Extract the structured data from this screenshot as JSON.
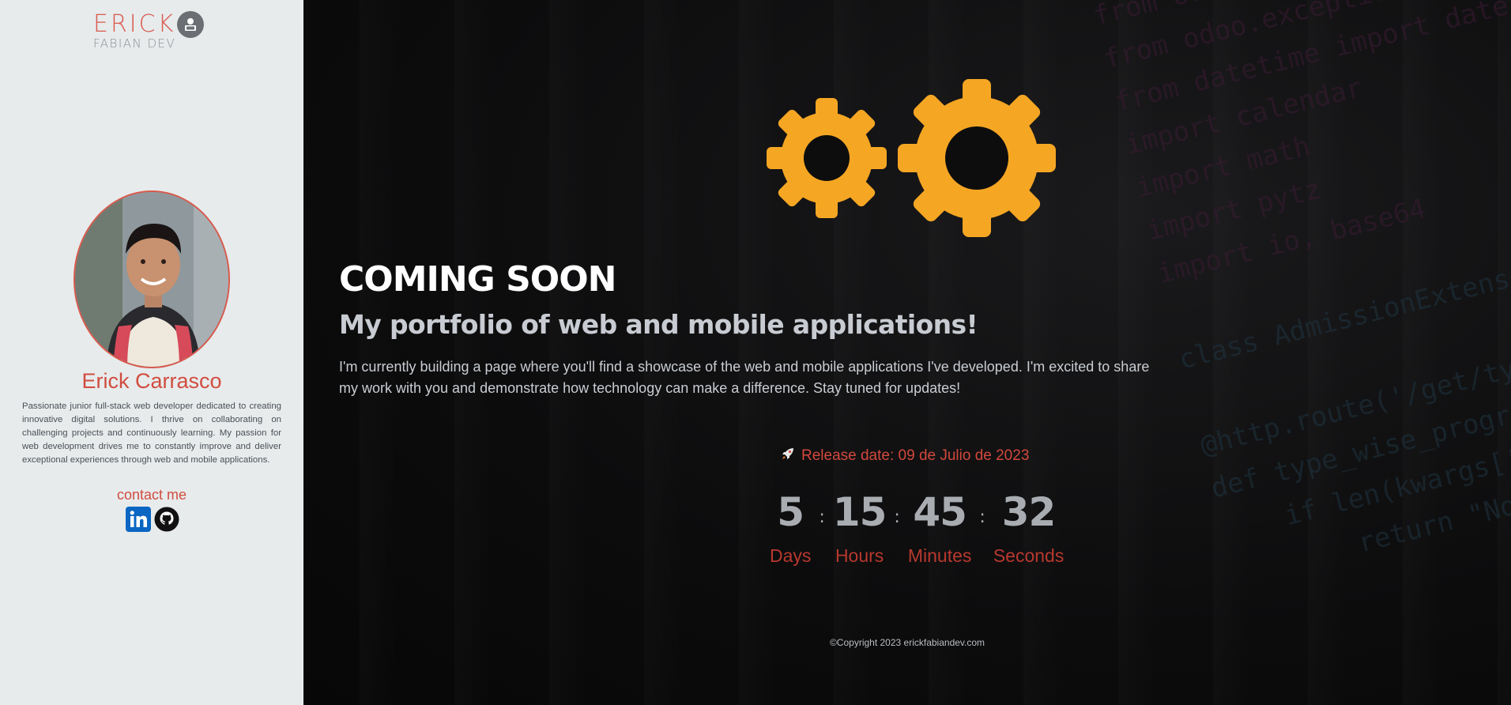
{
  "sidebar": {
    "logo_text": "ERICK",
    "logo_sub": "FABIAN DEV",
    "name": "Erick Carrasco",
    "bio": "Passionate junior full-stack web developer dedicated to creating innovative digital solutions. I thrive on collaborating on challenging projects and continuously learning. My passion for web development drives me to constantly improve and deliver exceptional experiences through web and mobile applications.",
    "contact_label": "contact me",
    "socials": [
      {
        "icon": "linkedin-icon"
      },
      {
        "icon": "github-icon"
      }
    ]
  },
  "main": {
    "title": "COMING SOON",
    "subtitle": "My portfolio of web and mobile applications!",
    "description": "I'm currently building a page where you'll find a showcase of the web and mobile applications I've developed. I'm excited to share my work with you and demonstrate how technology can make a difference. Stay tuned for updates!",
    "release": "Release date: 09 de Julio de 2023",
    "countdown": {
      "days": "5",
      "hours": "15",
      "minutes": "45",
      "seconds": "32",
      "days_label": "Days",
      "hours_label": "Hours",
      "minutes_label": "Minutes",
      "seconds_label": "Seconds"
    },
    "footer": "©Copyright 2023 erickfabiandev.com"
  },
  "colors": {
    "accent": "#d14d3f",
    "gear": "#f5a623",
    "sidebar_bg": "#e7ebec"
  }
}
